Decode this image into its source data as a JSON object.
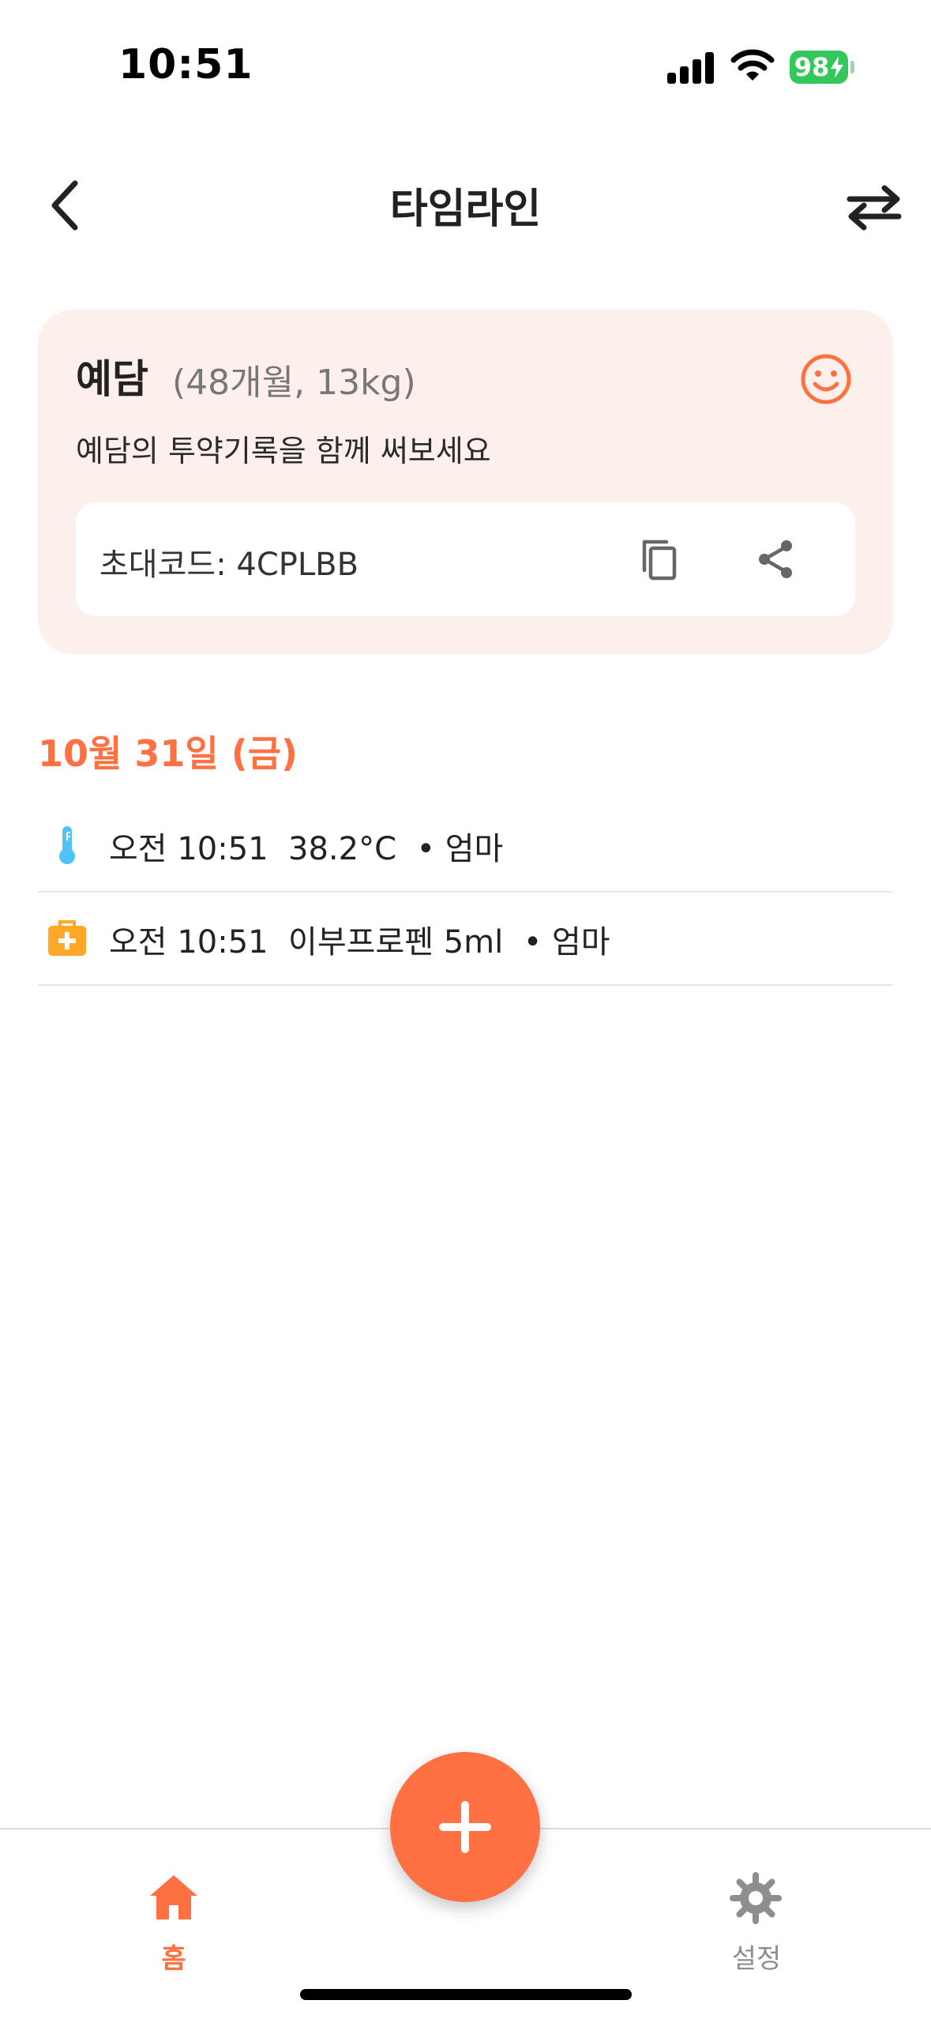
{
  "status_bar": {
    "time": "10:51",
    "battery": "98"
  },
  "nav": {
    "title": "타임라인"
  },
  "profile": {
    "name": "예담",
    "meta": "(48개월, 13kg)",
    "description": "예담의 투약기록을 함께 써보세요",
    "invite_label": "초대코드: 4CPLBB"
  },
  "timeline": {
    "date": "10월 31일 (금)",
    "entries": [
      {
        "text": "오전 10:51  38.2°C  • 엄마",
        "icon": "thermometer-icon"
      },
      {
        "text": "오전 10:51  이부프로펜 5ml  • 엄마",
        "icon": "medicine-kit-icon"
      }
    ]
  },
  "tabs": {
    "home": "홈",
    "settings": "설정"
  },
  "colors": {
    "accent": "#ff7043",
    "card_bg": "#fdf0ec",
    "thermometer": "#4fc3f7",
    "medicine": "#ffa726",
    "battery": "#34c759"
  }
}
